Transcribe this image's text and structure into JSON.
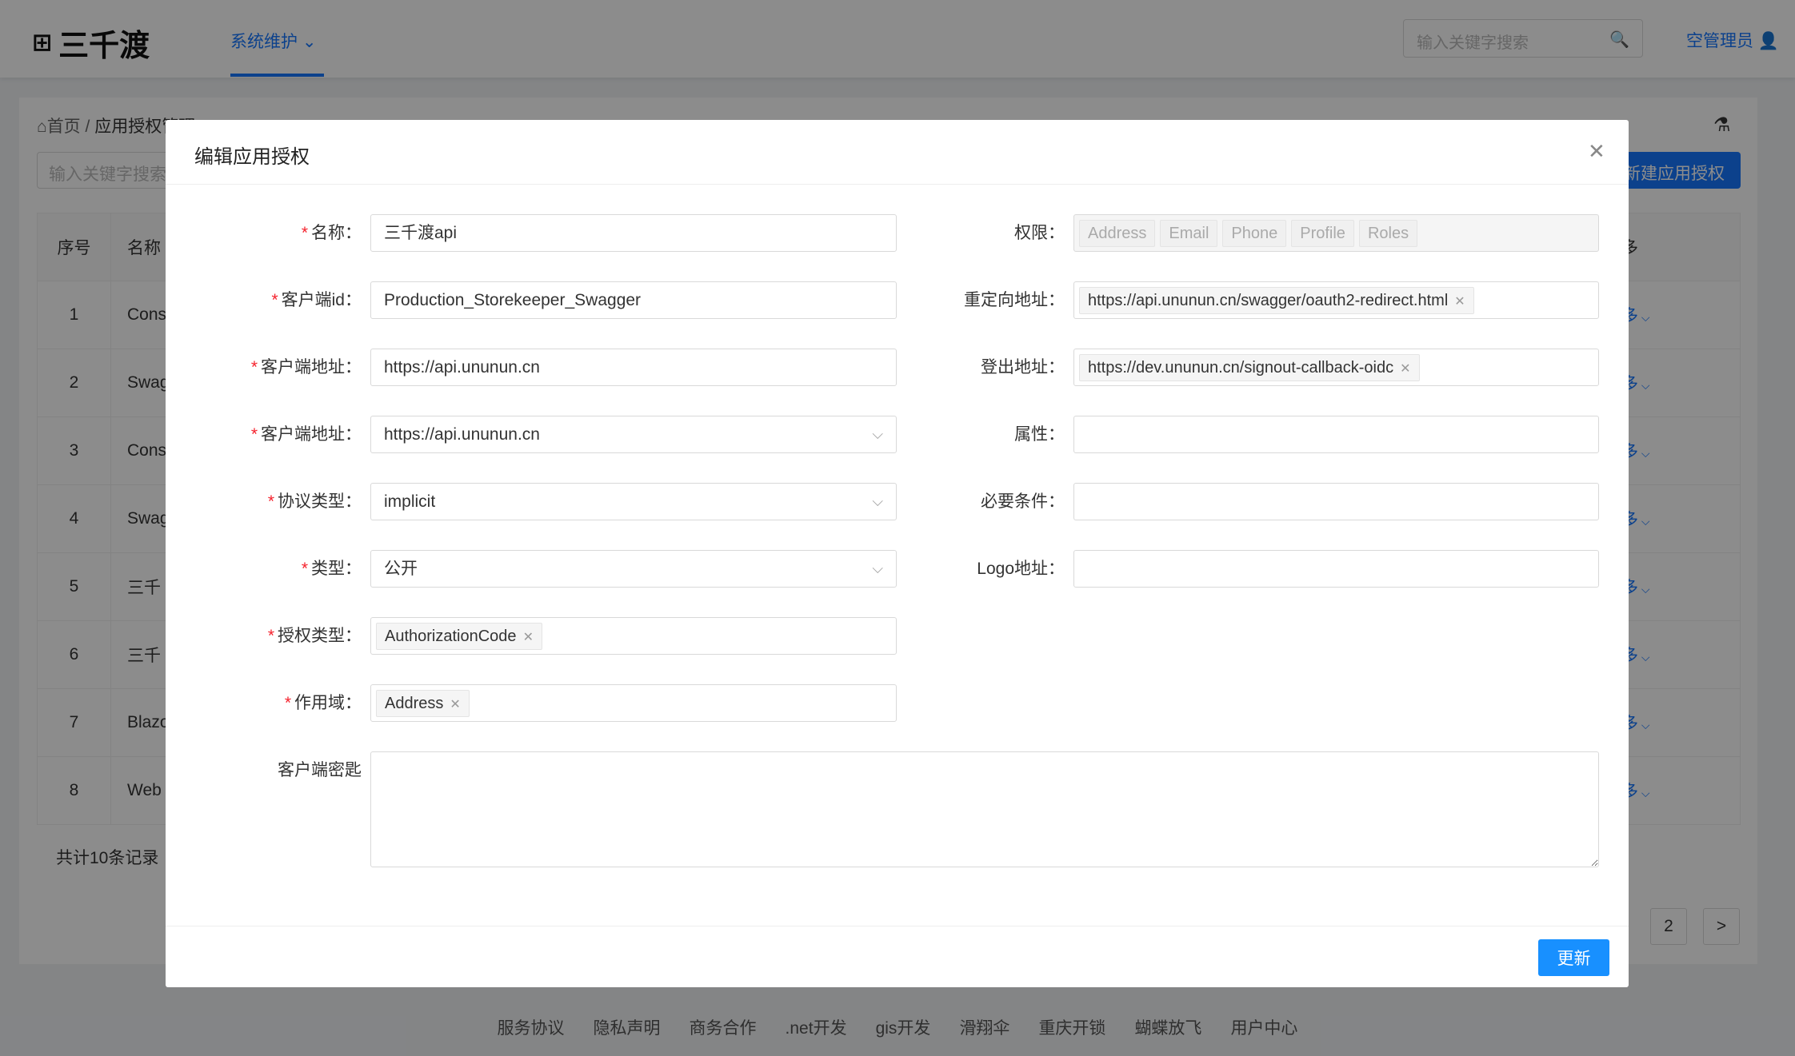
{
  "header": {
    "logo": "三千渡",
    "nav": "系统维护",
    "search_placeholder": "输入关键字搜索",
    "user": "空管理员"
  },
  "page": {
    "breadcrumb_home": "首页",
    "breadcrumb_current": "应用授权管理",
    "search_placeholder": "输入关键字搜索",
    "new_button": "新建应用授权",
    "table": {
      "headers": [
        "序号",
        "名称",
        "更多"
      ],
      "rows": [
        [
          "1",
          "Cons",
          "更多"
        ],
        [
          "2",
          "Swag",
          "更多"
        ],
        [
          "3",
          "Cons",
          "更多"
        ],
        [
          "4",
          "Swag",
          "更多"
        ],
        [
          "5",
          "三千",
          "更多"
        ],
        [
          "6",
          "三千",
          "更多"
        ],
        [
          "7",
          "Blazo",
          "更多"
        ],
        [
          "8",
          "Web",
          "更多"
        ]
      ]
    },
    "total": "共计10条记录",
    "pagination": [
      "2",
      ">"
    ]
  },
  "footer": [
    "服务协议",
    "隐私声明",
    "商务合作",
    ".net开发",
    "gis开发",
    "滑翔伞",
    "重庆开锁",
    "蝴蝶放飞",
    "用户中心"
  ],
  "dialog": {
    "title": "编辑应用授权",
    "submit": "更新",
    "left": [
      {
        "label": "名称",
        "required": true,
        "value": "三千渡api",
        "kind": "input"
      },
      {
        "label": "客户端id",
        "required": true,
        "value": "Production_Storekeeper_Swagger",
        "kind": "input"
      },
      {
        "label": "客户端地址",
        "required": true,
        "value": "https://api.ununun.cn",
        "kind": "input"
      },
      {
        "label": "客户端地址",
        "required": true,
        "value": "https://api.ununun.cn",
        "kind": "select"
      },
      {
        "label": "协议类型",
        "required": true,
        "value": "implicit",
        "kind": "select"
      },
      {
        "label": "类型",
        "required": true,
        "value": "公开",
        "kind": "select"
      },
      {
        "label": "授权类型",
        "required": true,
        "tags": [
          "AuthorizationCode"
        ],
        "kind": "tags"
      },
      {
        "label": "作用域",
        "required": true,
        "tags": [
          "Address"
        ],
        "kind": "tags"
      }
    ],
    "right": [
      {
        "label": "权限",
        "disabled_tags": [
          "Address",
          "Email",
          "Phone",
          "Profile",
          "Roles"
        ],
        "kind": "disabled"
      },
      {
        "label": "重定向地址",
        "tags": [
          "https://api.ununun.cn/swagger/oauth2-redirect.html"
        ],
        "kind": "tags"
      },
      {
        "label": "登出地址",
        "tags": [
          "https://dev.ununun.cn/signout-callback-oidc"
        ],
        "kind": "tags"
      },
      {
        "label": "属性",
        "value": "",
        "kind": "input"
      },
      {
        "label": "必要条件",
        "value": "",
        "kind": "input"
      },
      {
        "label": "Logo地址",
        "value": "",
        "kind": "input"
      }
    ],
    "secret_label": "客户端密匙"
  }
}
